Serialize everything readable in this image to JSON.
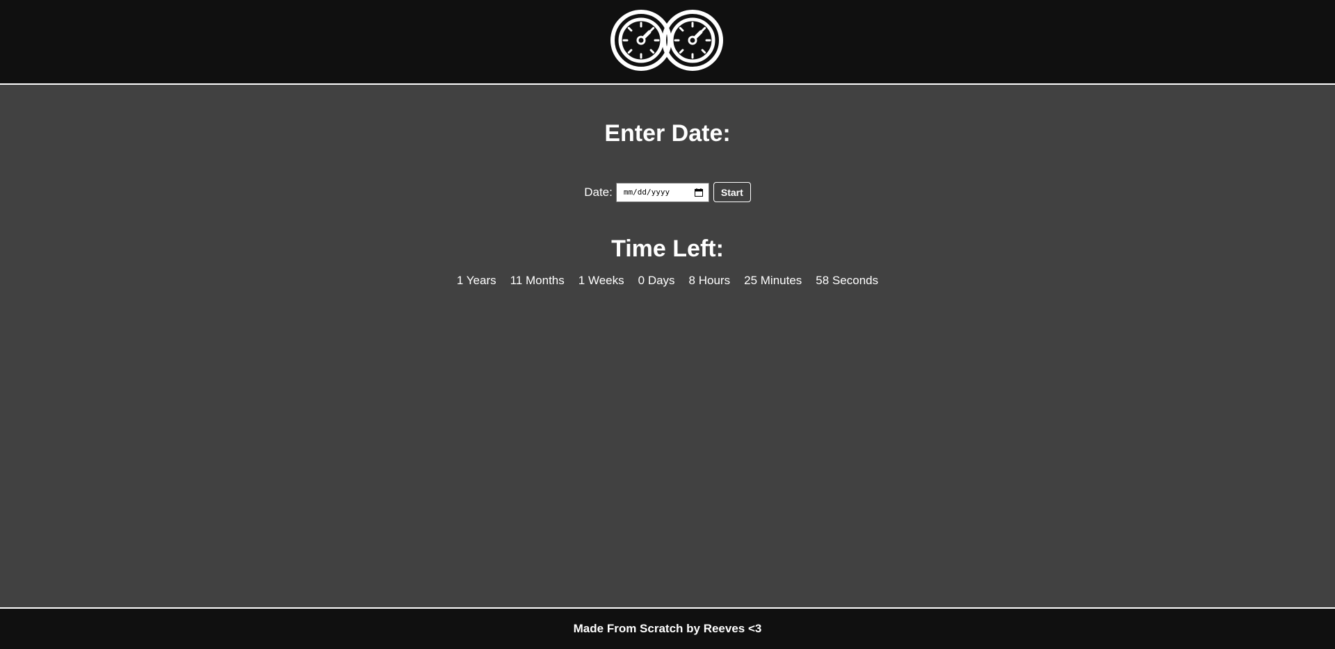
{
  "header": {
    "logo_icon": "twin-stopwatch-icon"
  },
  "main": {
    "enter_heading": "Enter Date:",
    "date_label": "Date:",
    "date_placeholder": "mm/dd/yyyy",
    "calendar_icon": "calendar-icon",
    "start_label": "Start",
    "time_heading": "Time Left:",
    "countdown": [
      {
        "value": "1",
        "unit": "Years"
      },
      {
        "value": "11",
        "unit": "Months"
      },
      {
        "value": "1",
        "unit": "Weeks"
      },
      {
        "value": "0",
        "unit": "Days"
      },
      {
        "value": "8",
        "unit": "Hours"
      },
      {
        "value": "25",
        "unit": "Minutes"
      },
      {
        "value": "58",
        "unit": "Seconds"
      }
    ]
  },
  "footer": {
    "text": "Made From Scratch by Reeves <3"
  },
  "colors": {
    "header_bg": "#101010",
    "main_bg": "#414141",
    "text": "#ffffff"
  }
}
